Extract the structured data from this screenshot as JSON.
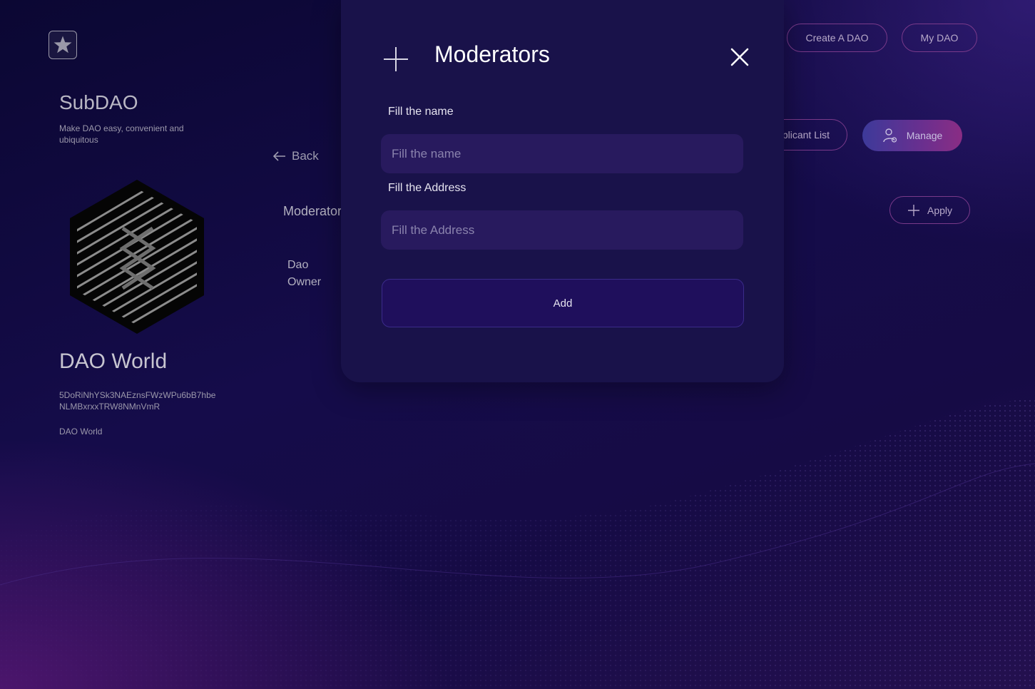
{
  "brand": {
    "title": "SubDAO",
    "tagline": "Make DAO easy, convenient and ubiquitous"
  },
  "header": {
    "create_dao_label": "Create A DAO",
    "my_dao_label": "My DAO"
  },
  "dao": {
    "name": "DAO World",
    "address": "5DoRiNhYSk3NAEznsFWzWPu6bB7hbeNLMBxrxxTRW8NMnVmR",
    "description": "DAO World"
  },
  "nav": {
    "back_label": "Back"
  },
  "tabs": {
    "applicant_list_label": "Applicant List",
    "manage_label": "Manage"
  },
  "moderators_section": {
    "label": "Moderators",
    "owner_label": "Dao Owner",
    "apply_label": "Apply"
  },
  "modal": {
    "title": "Moderators",
    "name_label": "Fill the name",
    "name_placeholder": "Fill the name",
    "address_label": "Fill the Address",
    "address_placeholder": "Fill the Address",
    "add_label": "Add"
  },
  "icons": {
    "logo": "star-icon",
    "back": "arrow-left-icon",
    "manage": "user-gear-icon",
    "apply": "plus-icon",
    "modal_header": "plus-icon",
    "close": "close-icon"
  },
  "colors": {
    "modal_bg": "#19124a",
    "input_bg": "#281a5e",
    "pill_border": "#7a3a8a",
    "manage_gradient_start": "#3d3a9a",
    "manage_gradient_end": "#8a2d84"
  }
}
